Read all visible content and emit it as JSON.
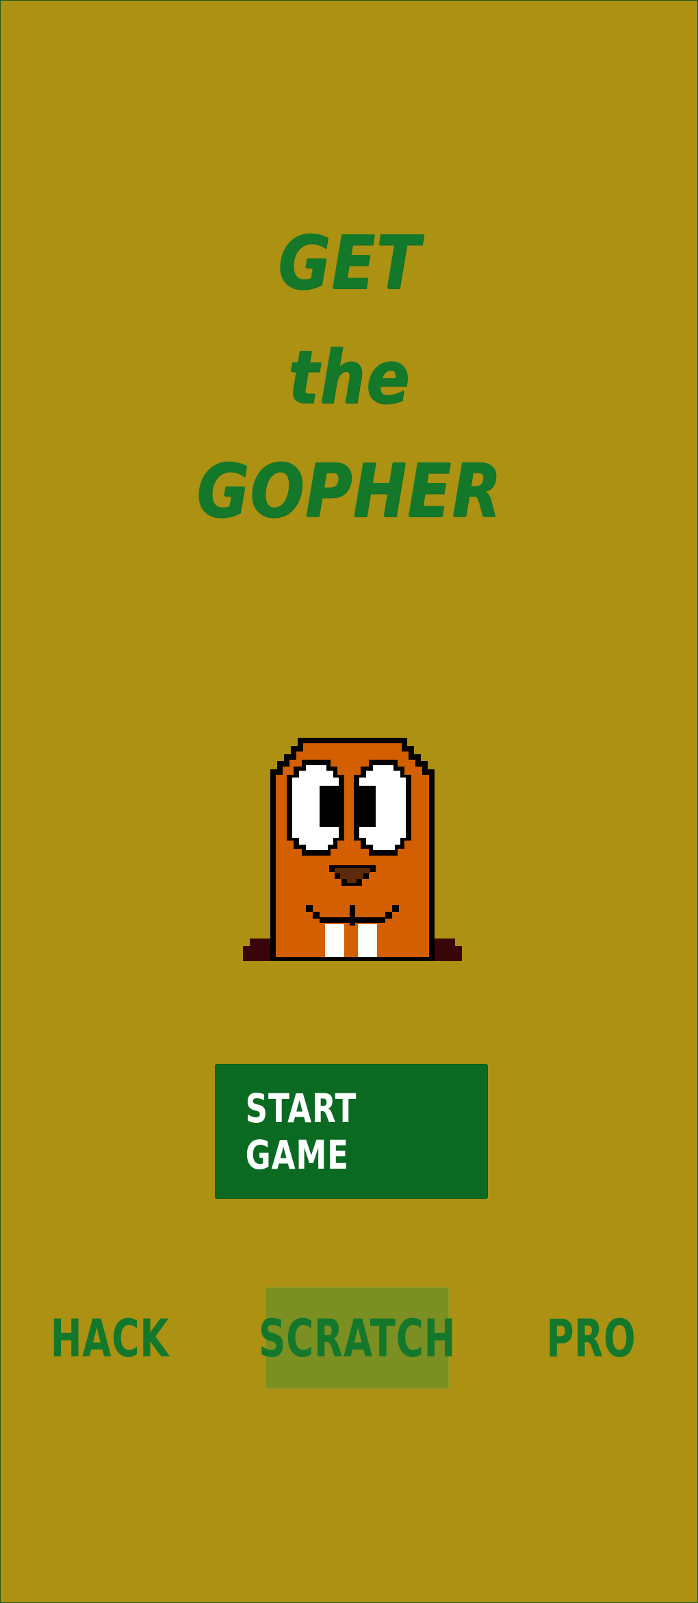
{
  "title": {
    "line1": "GET",
    "line2": "the",
    "line3": "GOPHER"
  },
  "gopher": {
    "icon": "gopher-pixel-art",
    "colors": {
      "fur": "#d35f00",
      "outline": "#000000",
      "eyes": "#ffffff",
      "nose": "#5a2a0a",
      "teeth": "#ffffff",
      "dirt": "#3a0508"
    }
  },
  "start_button": {
    "label": "START GAME"
  },
  "modes": {
    "hack": "HACK",
    "scratch": "SCRATCH",
    "pro": "PRO",
    "selected": "SCRATCH"
  },
  "colors": {
    "background": "#ad9112",
    "title": "#14782a",
    "button": "#0b6a22",
    "button_text": "#ffffff",
    "mode_text": "#13782b",
    "selected_mode_bg": "#7c8f22"
  }
}
